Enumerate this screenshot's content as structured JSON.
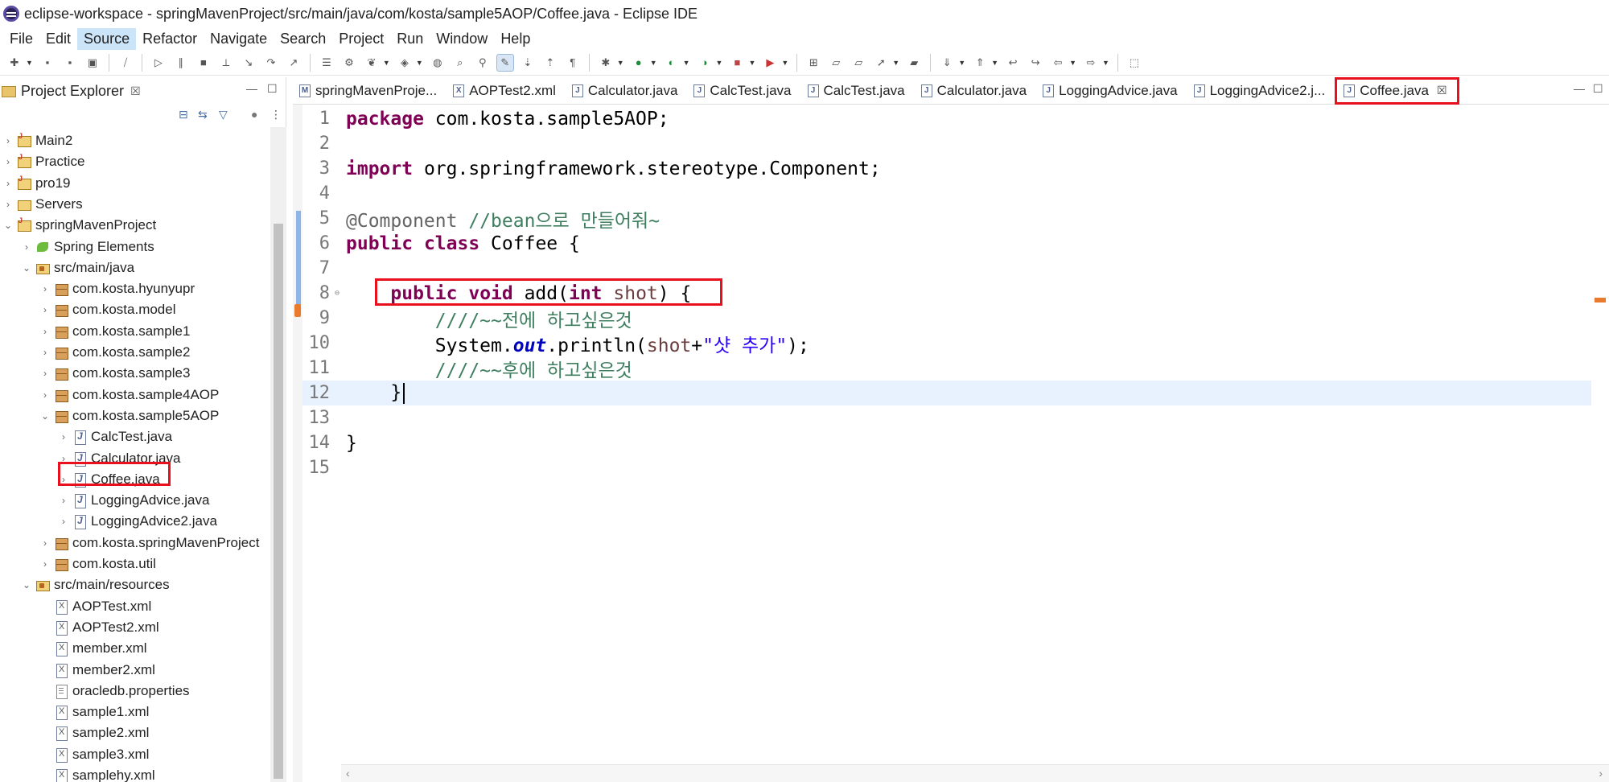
{
  "window": {
    "title": "eclipse-workspace - springMavenProject/src/main/java/com/kosta/sample5AOP/Coffee.java - Eclipse IDE"
  },
  "menu": [
    "File",
    "Edit",
    "Source",
    "Refactor",
    "Navigate",
    "Search",
    "Project",
    "Run",
    "Window",
    "Help"
  ],
  "active_menu": "Source",
  "explorer": {
    "title": "Project Explorer",
    "close": "☒",
    "tree": [
      {
        "label": "Main2",
        "icon": "project-icon",
        "twisty": "›"
      },
      {
        "label": "Practice",
        "icon": "project-icon",
        "twisty": "›"
      },
      {
        "label": "pro19",
        "icon": "project-icon",
        "twisty": "›"
      },
      {
        "label": "Servers",
        "icon": "server-folder-icon",
        "twisty": "›"
      },
      {
        "label": "springMavenProject",
        "icon": "project-icon",
        "twisty": "⌄"
      },
      {
        "label": "Spring Elements",
        "icon": "spring-icon",
        "twisty": "›"
      },
      {
        "label": "src/main/java",
        "icon": "source-folder-icon",
        "twisty": "⌄"
      },
      {
        "label": "com.kosta.hyunyupr",
        "icon": "package-icon",
        "twisty": "›"
      },
      {
        "label": "com.kosta.model",
        "icon": "package-icon",
        "twisty": "›"
      },
      {
        "label": "com.kosta.sample1",
        "icon": "package-icon",
        "twisty": "›"
      },
      {
        "label": "com.kosta.sample2",
        "icon": "package-icon",
        "twisty": "›"
      },
      {
        "label": "com.kosta.sample3",
        "icon": "package-icon",
        "twisty": "›"
      },
      {
        "label": "com.kosta.sample4AOP",
        "icon": "package-icon",
        "twisty": "›"
      },
      {
        "label": "com.kosta.sample5AOP",
        "icon": "package-icon",
        "twisty": "⌄"
      },
      {
        "label": "CalcTest.java",
        "icon": "java-file-icon",
        "twisty": "›"
      },
      {
        "label": "Calculator.java",
        "icon": "java-file-icon",
        "twisty": "›"
      },
      {
        "label": "Coffee.java",
        "icon": "java-file-icon",
        "twisty": "›"
      },
      {
        "label": "LoggingAdvice.java",
        "icon": "java-file-icon",
        "twisty": "›"
      },
      {
        "label": "LoggingAdvice2.java",
        "icon": "java-file-icon",
        "twisty": "›"
      },
      {
        "label": "com.kosta.springMavenProject",
        "icon": "package-icon",
        "twisty": "›"
      },
      {
        "label": "com.kosta.util",
        "icon": "package-icon",
        "twisty": "›"
      },
      {
        "label": "src/main/resources",
        "icon": "source-folder-icon",
        "twisty": "⌄"
      },
      {
        "label": "AOPTest.xml",
        "icon": "xml-file-icon",
        "twisty": ""
      },
      {
        "label": "AOPTest2.xml",
        "icon": "xml-file-icon",
        "twisty": ""
      },
      {
        "label": "member.xml",
        "icon": "xml-file-icon",
        "twisty": ""
      },
      {
        "label": "member2.xml",
        "icon": "xml-file-icon",
        "twisty": ""
      },
      {
        "label": "oracledb.properties",
        "icon": "properties-file-icon",
        "twisty": ""
      },
      {
        "label": "sample1.xml",
        "icon": "xml-file-icon",
        "twisty": ""
      },
      {
        "label": "sample2.xml",
        "icon": "xml-file-icon",
        "twisty": ""
      },
      {
        "label": "sample3.xml",
        "icon": "xml-file-icon",
        "twisty": ""
      },
      {
        "label": "samplehy.xml",
        "icon": "xml-file-icon",
        "twisty": ""
      }
    ]
  },
  "editor": {
    "tabs": [
      {
        "label": "springMavenProje...",
        "icon": "M"
      },
      {
        "label": "AOPTest2.xml",
        "icon": "X"
      },
      {
        "label": "Calculator.java",
        "icon": "J"
      },
      {
        "label": "CalcTest.java",
        "icon": "J"
      },
      {
        "label": "CalcTest.java",
        "icon": "J"
      },
      {
        "label": "Calculator.java",
        "icon": "J"
      },
      {
        "label": "LoggingAdvice.java",
        "icon": "J"
      },
      {
        "label": "LoggingAdvice2.j...",
        "icon": "J"
      },
      {
        "label": "Coffee.java",
        "icon": "J",
        "active": true
      }
    ],
    "active_tab_close": "☒",
    "line_numbers": [
      "1",
      "2",
      "3",
      "4",
      "5",
      "6",
      "7",
      "8",
      "9",
      "10",
      "11",
      "12",
      "13",
      "14",
      "15"
    ],
    "code": {
      "l1_kw": "package",
      "l1_rest": " com.kosta.sample5AOP;",
      "l3_kw": "import",
      "l3_rest": " org.springframework.stereotype.Component;",
      "l5_ann": "@Component",
      "l5_cm": " //bean으로 만들어줘~",
      "l6_kw1": "public",
      "l6_kw2": "class",
      "l6_rest": " Coffee {",
      "l8_kw1": "public",
      "l8_kw2": "void",
      "l8_mid": " add(",
      "l8_kw3": "int",
      "l8_var": " shot",
      "l8_end": ") {",
      "l9_cm": "////~~전에 하고싶은것",
      "l10_a": "System.",
      "l10_fld": "out",
      "l10_b": ".println(",
      "l10_var": "shot",
      "l10_c": "+",
      "l10_str": "\"샷 추가\"",
      "l10_d": ");",
      "l11_cm": "////~~후에 하고싶은것",
      "l12": "}",
      "l14": "}"
    }
  },
  "colors": {
    "highlight": "#e8101c",
    "keyword": "#7f0055",
    "comment": "#3f7f5f",
    "string": "#2a00ff",
    "current_line": "#e8f2fe"
  }
}
